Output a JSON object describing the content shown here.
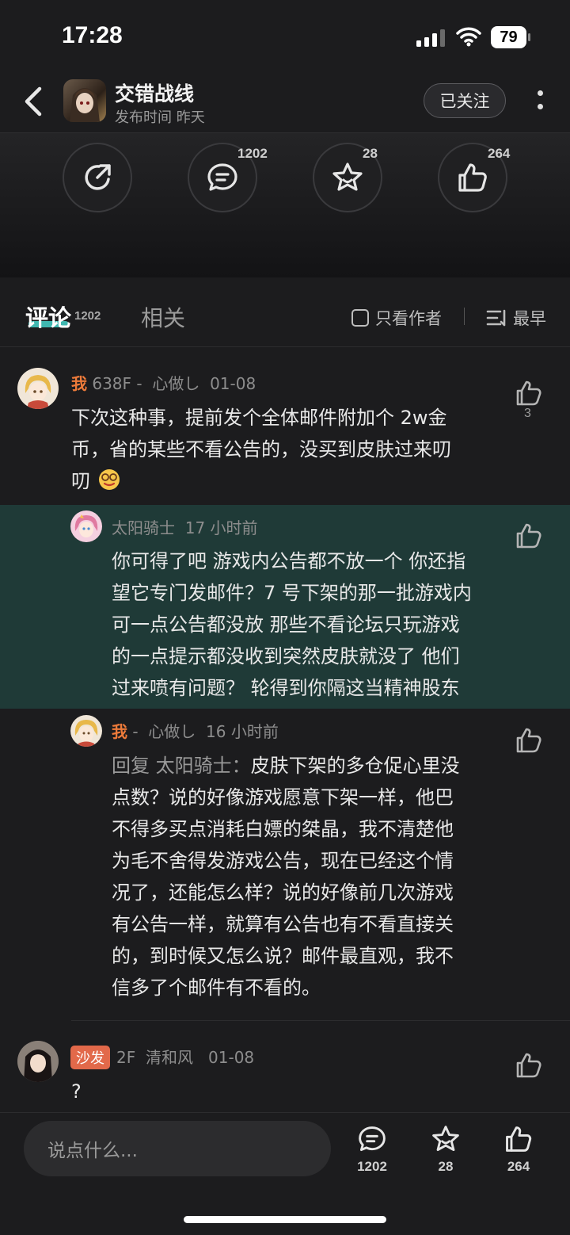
{
  "status_bar": {
    "time": "17:28",
    "battery": "79"
  },
  "header": {
    "title": "交错战线",
    "subtitle": "发布时间 昨天",
    "follow_label": "已关注"
  },
  "actions": {
    "share_count": "",
    "comment_count": "1202",
    "favorite_count": "28",
    "like_count": "264"
  },
  "tabs": {
    "comment_label": "评论",
    "comment_count": "1202",
    "related_label": "相关",
    "author_only_label": "只看作者",
    "sort_label": "最早"
  },
  "comments": [
    {
      "user": "我",
      "floor": "638F",
      "sep": "-",
      "nickname": "心做し",
      "date": "01-08",
      "lines": [
        "下次这种事，提前发个全体邮件附加个 2w金",
        "币，省的某些不看公告的，没买到皮肤过来叨",
        "叨"
      ],
      "likes": "3"
    }
  ],
  "replies": [
    {
      "user": "太阳骑士",
      "time": "17 小时前",
      "lines": [
        "你可得了吧 游戏内公告都不放一个 你还指",
        "望它专门发邮件？7 号下架的那一批游戏内",
        "可一点公告都没放 那些不看论坛只玩游戏",
        "的一点提示都没收到突然皮肤就没了 他们",
        "过来喷有问题？ 轮得到你隔这当精神股东"
      ]
    },
    {
      "user": "我",
      "sep": "-",
      "nickname": "心做し",
      "time": "16 小时前",
      "reply_prefix": "回复 太阳骑士：",
      "lines": [
        "皮肤下架的多仓促心里没",
        "点数？说的好像游戏愿意下架一样，他巴",
        "不得多买点消耗白嫖的桀晶，我不清楚他",
        "为毛不舍得发游戏公告，现在已经这个情",
        "况了，还能怎么样？说的好像前几次游戏",
        "有公告一样，就算有公告也有不看直接关",
        "的，到时候又怎么说？邮件最直观，我不",
        "信多了个邮件有不看的。"
      ]
    }
  ],
  "comment2": {
    "badge": "沙发",
    "floor": "2F",
    "nickname": "清和风",
    "date": "01-08",
    "text": "?"
  },
  "bottom": {
    "input_placeholder": "说点什么...",
    "comments": "1202",
    "favorites": "28",
    "likes": "264"
  },
  "colors": {
    "accent": "#3fb7b0",
    "me": "#ee7b3a",
    "highlight_bg": "#1f3a37"
  },
  "icons": [
    "back-icon",
    "share-icon",
    "comment-icon",
    "star-icon",
    "thumbs-up-icon",
    "more-icon",
    "sort-icon"
  ]
}
